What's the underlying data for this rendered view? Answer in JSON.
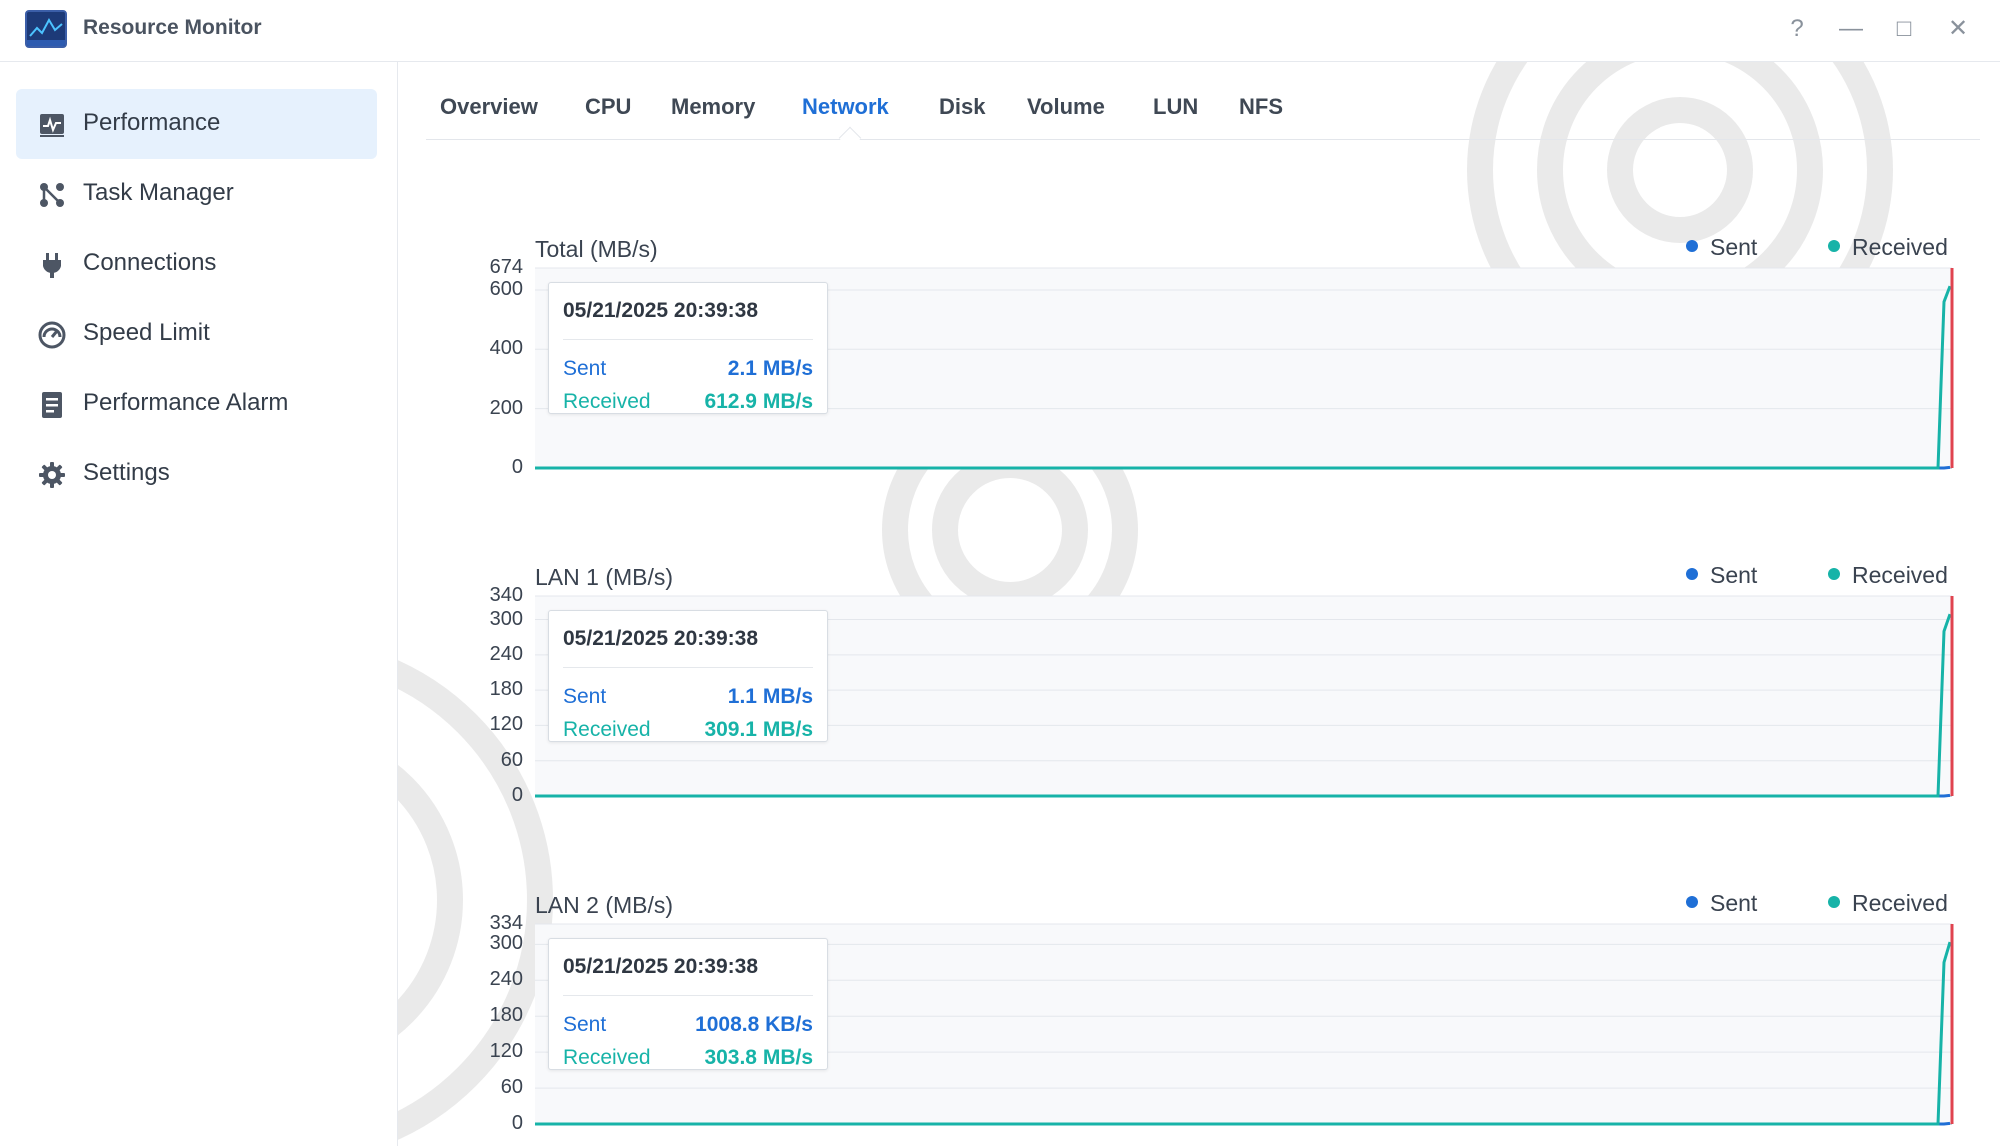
{
  "app": {
    "title": "Resource Monitor"
  },
  "window_controls": {
    "help": "?",
    "minimize": "—",
    "maximize": "□",
    "close": "✕"
  },
  "sidebar": {
    "items": [
      {
        "label": "Performance",
        "icon": "performance-icon",
        "active": true
      },
      {
        "label": "Task Manager",
        "icon": "task-manager-icon",
        "active": false
      },
      {
        "label": "Connections",
        "icon": "plug-icon",
        "active": false
      },
      {
        "label": "Speed Limit",
        "icon": "speedometer-icon",
        "active": false
      },
      {
        "label": "Performance Alarm",
        "icon": "alarm-list-icon",
        "active": false
      },
      {
        "label": "Settings",
        "icon": "gear-icon",
        "active": false
      }
    ]
  },
  "tabs": [
    {
      "label": "Overview",
      "active": false
    },
    {
      "label": "CPU",
      "active": false
    },
    {
      "label": "Memory",
      "active": false
    },
    {
      "label": "Network",
      "active": true
    },
    {
      "label": "Disk",
      "active": false
    },
    {
      "label": "Volume",
      "active": false
    },
    {
      "label": "LUN",
      "active": false
    },
    {
      "label": "NFS",
      "active": false
    }
  ],
  "colors": {
    "sent": "#1f6fd6",
    "received": "#17b3a8",
    "cursor": "#e0434f",
    "accent": "#1f6fd6"
  },
  "chart_data": [
    {
      "type": "line",
      "title": "Total (MB/s)",
      "legend": [
        "Sent",
        "Received"
      ],
      "ylim": [
        0,
        674
      ],
      "ticks": [
        "674",
        "600",
        "400",
        "200",
        "0"
      ],
      "tick_values": [
        674,
        600,
        400,
        200,
        0
      ],
      "series": [
        {
          "name": "Sent",
          "values": [
            0,
            0,
            0,
            0,
            2.1
          ]
        },
        {
          "name": "Received",
          "values": [
            0,
            0,
            0,
            560,
            612.9
          ]
        }
      ],
      "tooltip": {
        "time": "05/21/2025 20:39:38",
        "sent_label": "Sent",
        "sent_value": "2.1 MB/s",
        "received_label": "Received",
        "received_value": "612.9 MB/s"
      }
    },
    {
      "type": "line",
      "title": "LAN 1 (MB/s)",
      "legend": [
        "Sent",
        "Received"
      ],
      "ylim": [
        0,
        340
      ],
      "ticks": [
        "340",
        "300",
        "240",
        "180",
        "120",
        "60",
        "0"
      ],
      "tick_values": [
        340,
        300,
        240,
        180,
        120,
        60,
        0
      ],
      "series": [
        {
          "name": "Sent",
          "values": [
            0,
            0,
            0,
            0,
            1.1
          ]
        },
        {
          "name": "Received",
          "values": [
            0,
            0,
            0,
            280,
            309.1
          ]
        }
      ],
      "tooltip": {
        "time": "05/21/2025 20:39:38",
        "sent_label": "Sent",
        "sent_value": "1.1 MB/s",
        "received_label": "Received",
        "received_value": "309.1 MB/s"
      }
    },
    {
      "type": "line",
      "title": "LAN 2 (MB/s)",
      "legend": [
        "Sent",
        "Received"
      ],
      "ylim": [
        0,
        334
      ],
      "ticks": [
        "334",
        "300",
        "240",
        "180",
        "120",
        "60",
        "0"
      ],
      "tick_values": [
        334,
        300,
        240,
        180,
        120,
        60,
        0
      ],
      "series": [
        {
          "name": "Sent",
          "values": [
            0,
            0,
            0,
            0,
            1.0
          ]
        },
        {
          "name": "Received",
          "values": [
            0,
            0,
            0,
            270,
            303.8
          ]
        }
      ],
      "tooltip": {
        "time": "05/21/2025 20:39:38",
        "sent_label": "Sent",
        "sent_value": "1008.8 KB/s",
        "received_label": "Received",
        "received_value": "303.8 MB/s"
      }
    }
  ]
}
